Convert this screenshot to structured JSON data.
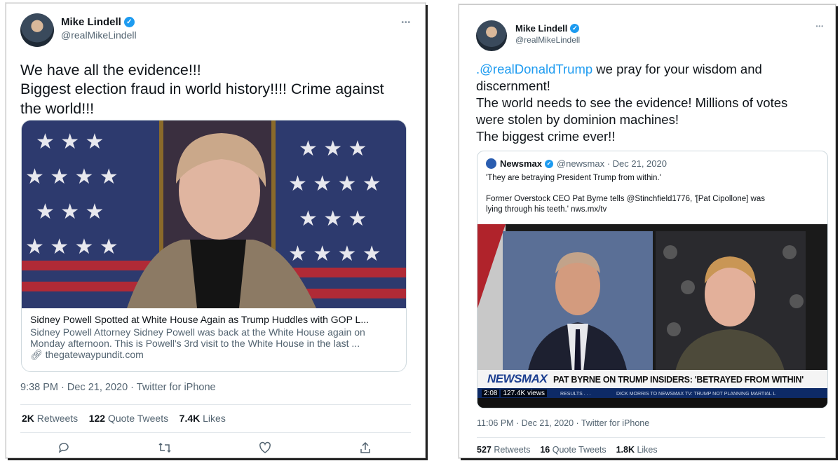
{
  "left": {
    "author_name": "Mike Lindell",
    "author_handle": "@realMikeLindell",
    "more_label": "•••",
    "text_lines": [
      "We have all the evidence!!!",
      "Biggest election fraud in world history!!!! Crime against",
      "the world!!!"
    ],
    "link_title": "Sidney Powell Spotted at White House Again as Trump Huddles with GOP L...",
    "link_desc_1": "Sidney Powell Attorney Sidney Powell was back at the White House again on",
    "link_desc_2": "Monday afternoon. This is Powell's 3rd visit to the White House in the last ...",
    "link_domain": "thegatewaypundit.com",
    "timestamp": "9:38 PM · Dec 21, 2020 · Twitter for iPhone",
    "retweets_count": "2K",
    "retweets_label": "Retweets",
    "quotes_count": "122",
    "quotes_label": "Quote Tweets",
    "likes_count": "7.4K",
    "likes_label": "Likes"
  },
  "right": {
    "author_name": "Mike Lindell",
    "author_handle": "@realMikeLindell",
    "more_label": "•••",
    "mention": ".@realDonaldTrump",
    "text_line_1_rest": " we pray for your wisdom and",
    "text_lines": [
      "discernment!",
      "The world needs to see the evidence! Millions of votes",
      "were stolen by dominion machines!",
      "The biggest crime ever!!"
    ],
    "quote_author": "Newsmax",
    "quote_handle_date": "@newsmax · Dec 21, 2020",
    "quote_line_1": "'They are betraying President Trump from within.'",
    "quote_line_2": "Former Overstock CEO Pat Byrne tells @Stinchfield1776, '[Pat Cipollone] was",
    "quote_line_3": "lying through his teeth.' nws.mx/tv",
    "chyron_brand": "NEWSMAX",
    "chyron_text": "PAT BYRNE ON TRUMP INSIDERS: 'BETRAYED FROM WITHIN'",
    "video_time": "2:08",
    "video_views": "127.4K views",
    "ticker_left": "RESULTS . . .",
    "ticker_right": "DICK MORRIS TO NEWSMAX TV: TRUMP NOT PLANNING MARTIAL L",
    "timestamp": "11:06 PM · Dec 21, 2020 · Twitter for iPhone",
    "retweets_count": "527",
    "retweets_label": "Retweets",
    "quotes_count": "16",
    "quotes_label": "Quote Tweets",
    "likes_count": "1.8K",
    "likes_label": "Likes"
  },
  "colors": {
    "accent": "#1d9bf0",
    "muted": "#536471",
    "text": "#0f1419"
  },
  "icons": [
    "verified-badge-icon",
    "more-icon",
    "reply-icon",
    "retweet-icon",
    "like-icon",
    "share-icon",
    "link-icon",
    "newsmax-logo-icon"
  ]
}
